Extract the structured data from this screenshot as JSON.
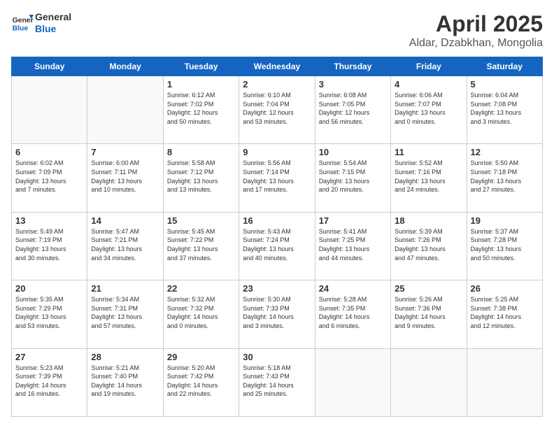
{
  "logo": {
    "line1": "General",
    "line2": "Blue"
  },
  "header": {
    "month": "April 2025",
    "location": "Aldar, Dzabkhan, Mongolia"
  },
  "weekdays": [
    "Sunday",
    "Monday",
    "Tuesday",
    "Wednesday",
    "Thursday",
    "Friday",
    "Saturday"
  ],
  "weeks": [
    [
      {
        "day": "",
        "info": ""
      },
      {
        "day": "",
        "info": ""
      },
      {
        "day": "1",
        "info": "Sunrise: 6:12 AM\nSunset: 7:02 PM\nDaylight: 12 hours\nand 50 minutes."
      },
      {
        "day": "2",
        "info": "Sunrise: 6:10 AM\nSunset: 7:04 PM\nDaylight: 12 hours\nand 53 minutes."
      },
      {
        "day": "3",
        "info": "Sunrise: 6:08 AM\nSunset: 7:05 PM\nDaylight: 12 hours\nand 56 minutes."
      },
      {
        "day": "4",
        "info": "Sunrise: 6:06 AM\nSunset: 7:07 PM\nDaylight: 13 hours\nand 0 minutes."
      },
      {
        "day": "5",
        "info": "Sunrise: 6:04 AM\nSunset: 7:08 PM\nDaylight: 13 hours\nand 3 minutes."
      }
    ],
    [
      {
        "day": "6",
        "info": "Sunrise: 6:02 AM\nSunset: 7:09 PM\nDaylight: 13 hours\nand 7 minutes."
      },
      {
        "day": "7",
        "info": "Sunrise: 6:00 AM\nSunset: 7:11 PM\nDaylight: 13 hours\nand 10 minutes."
      },
      {
        "day": "8",
        "info": "Sunrise: 5:58 AM\nSunset: 7:12 PM\nDaylight: 13 hours\nand 13 minutes."
      },
      {
        "day": "9",
        "info": "Sunrise: 5:56 AM\nSunset: 7:14 PM\nDaylight: 13 hours\nand 17 minutes."
      },
      {
        "day": "10",
        "info": "Sunrise: 5:54 AM\nSunset: 7:15 PM\nDaylight: 13 hours\nand 20 minutes."
      },
      {
        "day": "11",
        "info": "Sunrise: 5:52 AM\nSunset: 7:16 PM\nDaylight: 13 hours\nand 24 minutes."
      },
      {
        "day": "12",
        "info": "Sunrise: 5:50 AM\nSunset: 7:18 PM\nDaylight: 13 hours\nand 27 minutes."
      }
    ],
    [
      {
        "day": "13",
        "info": "Sunrise: 5:49 AM\nSunset: 7:19 PM\nDaylight: 13 hours\nand 30 minutes."
      },
      {
        "day": "14",
        "info": "Sunrise: 5:47 AM\nSunset: 7:21 PM\nDaylight: 13 hours\nand 34 minutes."
      },
      {
        "day": "15",
        "info": "Sunrise: 5:45 AM\nSunset: 7:22 PM\nDaylight: 13 hours\nand 37 minutes."
      },
      {
        "day": "16",
        "info": "Sunrise: 5:43 AM\nSunset: 7:24 PM\nDaylight: 13 hours\nand 40 minutes."
      },
      {
        "day": "17",
        "info": "Sunrise: 5:41 AM\nSunset: 7:25 PM\nDaylight: 13 hours\nand 44 minutes."
      },
      {
        "day": "18",
        "info": "Sunrise: 5:39 AM\nSunset: 7:26 PM\nDaylight: 13 hours\nand 47 minutes."
      },
      {
        "day": "19",
        "info": "Sunrise: 5:37 AM\nSunset: 7:28 PM\nDaylight: 13 hours\nand 50 minutes."
      }
    ],
    [
      {
        "day": "20",
        "info": "Sunrise: 5:35 AM\nSunset: 7:29 PM\nDaylight: 13 hours\nand 53 minutes."
      },
      {
        "day": "21",
        "info": "Sunrise: 5:34 AM\nSunset: 7:31 PM\nDaylight: 13 hours\nand 57 minutes."
      },
      {
        "day": "22",
        "info": "Sunrise: 5:32 AM\nSunset: 7:32 PM\nDaylight: 14 hours\nand 0 minutes."
      },
      {
        "day": "23",
        "info": "Sunrise: 5:30 AM\nSunset: 7:33 PM\nDaylight: 14 hours\nand 3 minutes."
      },
      {
        "day": "24",
        "info": "Sunrise: 5:28 AM\nSunset: 7:35 PM\nDaylight: 14 hours\nand 6 minutes."
      },
      {
        "day": "25",
        "info": "Sunrise: 5:26 AM\nSunset: 7:36 PM\nDaylight: 14 hours\nand 9 minutes."
      },
      {
        "day": "26",
        "info": "Sunrise: 5:25 AM\nSunset: 7:38 PM\nDaylight: 14 hours\nand 12 minutes."
      }
    ],
    [
      {
        "day": "27",
        "info": "Sunrise: 5:23 AM\nSunset: 7:39 PM\nDaylight: 14 hours\nand 16 minutes."
      },
      {
        "day": "28",
        "info": "Sunrise: 5:21 AM\nSunset: 7:40 PM\nDaylight: 14 hours\nand 19 minutes."
      },
      {
        "day": "29",
        "info": "Sunrise: 5:20 AM\nSunset: 7:42 PM\nDaylight: 14 hours\nand 22 minutes."
      },
      {
        "day": "30",
        "info": "Sunrise: 5:18 AM\nSunset: 7:43 PM\nDaylight: 14 hours\nand 25 minutes."
      },
      {
        "day": "",
        "info": ""
      },
      {
        "day": "",
        "info": ""
      },
      {
        "day": "",
        "info": ""
      }
    ]
  ]
}
